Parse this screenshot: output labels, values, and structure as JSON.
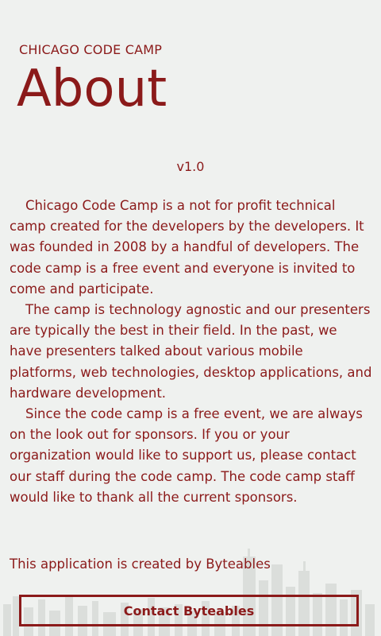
{
  "header": {
    "app_title": "CHICAGO CODE CAMP",
    "page_title": "About"
  },
  "version": "v1.0",
  "about": {
    "paragraphs": [
      "Chicago Code Camp is a not for profit technical camp created for the developers by the developers. It was founded in 2008 by a handful of developers. The code camp is a free event and everyone is invited to come and participate.",
      "The camp is technology agnostic and our presenters are typically the best in their field. In the past, we have presenters talked about various mobile platforms, web technologies, desktop applications, and hardware development.",
      "Since the code camp is a free event, we are always on the look out for sponsors. If you or your organization would like to support us, please contact our staff during the code camp. The code camp staff would like to thank all the current sponsors."
    ]
  },
  "credit": "This application is created by Byteables",
  "contact_button": {
    "label": "Contact Byteables"
  },
  "colors": {
    "background": "#eff1ef",
    "accent": "#8b1a1a"
  }
}
